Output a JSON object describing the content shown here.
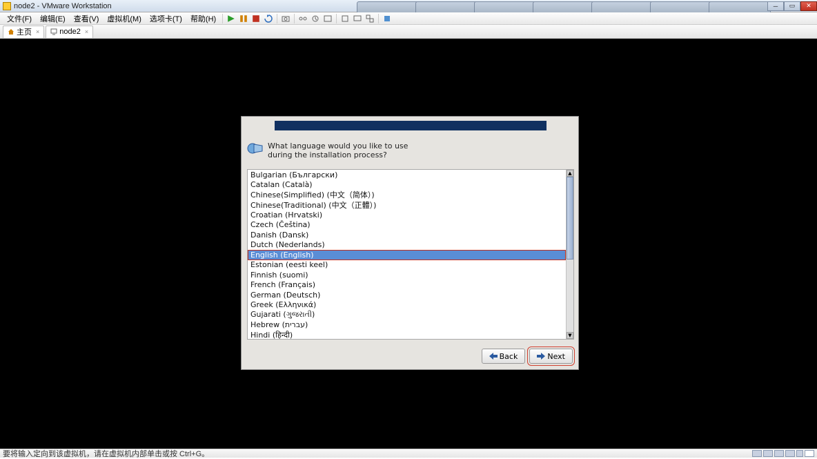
{
  "window": {
    "title": "node2 - VMware Workstation"
  },
  "menu": {
    "file": "文件(F)",
    "edit": "编辑(E)",
    "view": "查看(V)",
    "vm": "虚拟机(M)",
    "tabs_menu": "选项卡(T)",
    "help": "帮助(H)"
  },
  "tabs": {
    "home": "主页",
    "node2": "node2"
  },
  "installer": {
    "prompt": "What language would you like to use during the installation process?",
    "languages": [
      "Bulgarian (Български)",
      "Catalan (Català)",
      "Chinese(Simplified) (中文（简体）)",
      "Chinese(Traditional) (中文（正體）)",
      "Croatian (Hrvatski)",
      "Czech (Čeština)",
      "Danish (Dansk)",
      "Dutch (Nederlands)",
      "English (English)",
      "Estonian (eesti keel)",
      "Finnish (suomi)",
      "French (Français)",
      "German (Deutsch)",
      "Greek (Ελληνικά)",
      "Gujarati (ગુજરાતી)",
      "Hebrew (עברית)",
      "Hindi (हिन्दी)"
    ],
    "selected_index": 8,
    "back": "Back",
    "next": "Next"
  },
  "status": {
    "text": "要将输入定向到该虚拟机，请在虚拟机内部单击或按 Ctrl+G。"
  }
}
